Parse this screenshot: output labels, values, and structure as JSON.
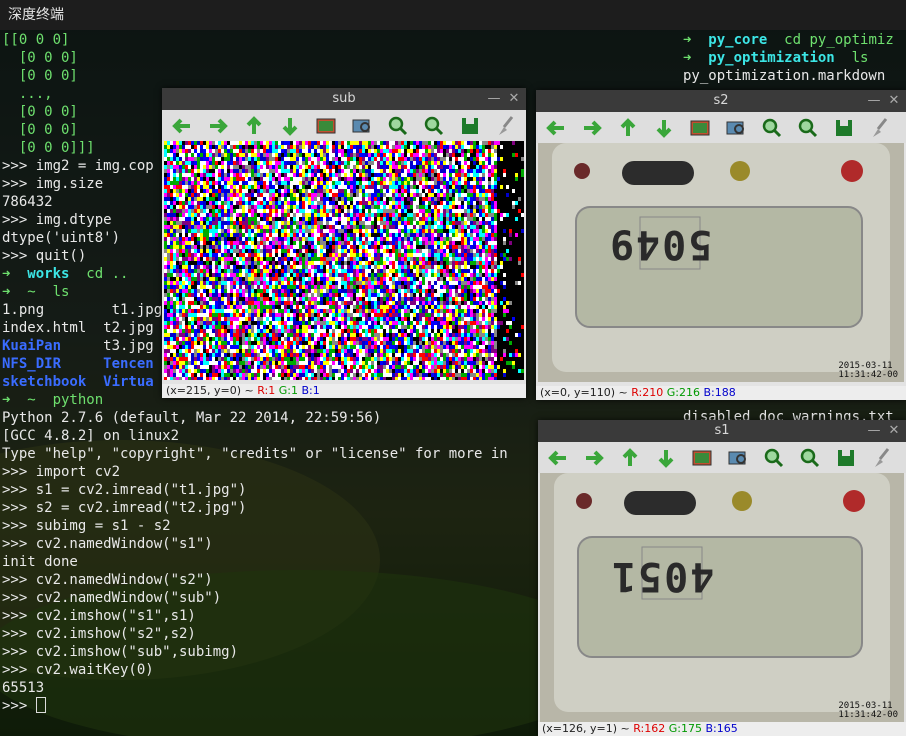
{
  "window_title": "深度终端",
  "terminal_lines": [
    [
      [
        "[[0 0 0]",
        "g"
      ]
    ],
    [
      [
        "  [0 0 0]",
        "g"
      ]
    ],
    [
      [
        "  [0 0 0]",
        "g"
      ]
    ],
    [
      [
        "  ...,",
        "g"
      ]
    ],
    [
      [
        "  [0 0 0]",
        "g"
      ]
    ],
    [
      [
        "  [0 0 0]",
        "g"
      ]
    ],
    [
      [
        "  [0 0 0]]]",
        "g"
      ]
    ],
    [
      [
        ">>> img2 = img.cop",
        "w"
      ]
    ],
    [
      [
        ">>> img.size",
        "w"
      ]
    ],
    [
      [
        "786432",
        "w"
      ]
    ],
    [
      [
        ">>> img.dtype",
        "w"
      ]
    ],
    [
      [
        "dtype('uint8')",
        "w"
      ]
    ],
    [
      [
        ">>> quit()",
        "w"
      ]
    ],
    [
      [
        "➜  ",
        "g"
      ],
      [
        "works",
        "c"
      ],
      [
        "  cd ..",
        "g"
      ]
    ],
    [
      [
        "➜  ~  ls",
        "g"
      ]
    ],
    [
      [
        "1.png        t1.jpg",
        "w"
      ]
    ],
    [
      [
        "index.html  t2.jpg",
        "w"
      ]
    ],
    [
      [
        "KuaiPan     ",
        "b"
      ],
      [
        "t3.jpg",
        "w"
      ]
    ],
    [
      [
        "NFS_DIR     Tencen",
        "b"
      ]
    ],
    [
      [
        "sketchbook  Virtua",
        "b"
      ]
    ],
    [
      [
        "➜  ~  python",
        "g"
      ]
    ],
    [
      [
        "Python 2.7.6 (default, Mar 22 2014, 22:59:56)",
        "w"
      ]
    ],
    [
      [
        "[GCC 4.8.2] on linux2",
        "w"
      ]
    ],
    [
      [
        "Type \"help\", \"copyright\", \"credits\" or \"license\" for more in",
        "w"
      ]
    ],
    [
      [
        ">>> import cv2",
        "w"
      ]
    ],
    [
      [
        ">>> s1 = cv2.imread(\"t1.jpg\")",
        "w"
      ]
    ],
    [
      [
        ">>> s2 = cv2.imread(\"t2.jpg\")",
        "w"
      ]
    ],
    [
      [
        ">>> subimg = s1 - s2",
        "w"
      ]
    ],
    [
      [
        ">>> cv2.namedWindow(\"s1\")",
        "w"
      ]
    ],
    [
      [
        "init done",
        "w"
      ]
    ],
    [
      [
        ">>> cv2.namedWindow(\"s2\")",
        "w"
      ]
    ],
    [
      [
        ">>> cv2.namedWindow(\"sub\")",
        "w"
      ]
    ],
    [
      [
        ">>> cv2.imshow(\"s1\",s1)",
        "w"
      ]
    ],
    [
      [
        ">>> cv2.imshow(\"s2\",s2)",
        "w"
      ]
    ],
    [
      [
        ">>> cv2.imshow(\"sub\",subimg)",
        "w"
      ]
    ],
    [
      [
        ">>> cv2.waitKey(0)",
        "w"
      ]
    ],
    [
      [
        "65513",
        "w"
      ]
    ],
    [
      [
        ">>> ",
        "w"
      ]
    ]
  ],
  "right_lines": [
    [
      [
        "➜  ",
        "g"
      ],
      [
        "py_core",
        "c"
      ],
      [
        "  cd py_optimiz",
        "g"
      ]
    ],
    [
      [
        "➜  ",
        "g"
      ],
      [
        "py_optimization",
        "c"
      ],
      [
        "  ls",
        "g"
      ]
    ],
    [
      [
        "py_optimization.markdown",
        "w"
      ]
    ]
  ],
  "right_extra": "disabled_doc_warnings.txt",
  "windows": {
    "sub": {
      "title": "sub",
      "status": "(x=215, y=0) ~ ",
      "r": "R:1",
      "g": "G:1",
      "b": "B:1"
    },
    "s2": {
      "title": "s2",
      "status": "(x=0, y=110) ~ ",
      "r": "R:210",
      "g": "G:216",
      "b": "B:188",
      "lcd": "5049",
      "timestamp": "2015-03-11\n11:31:42-00"
    },
    "s1": {
      "title": "s1",
      "status": "(x=126, y=1) ~ ",
      "r": "R:162",
      "g": "G:175",
      "b": "B:165",
      "lcd": "4051",
      "timestamp": "2015-03-11\n11:31:42-00"
    }
  },
  "toolbar_icons": [
    "arrow-left-icon",
    "arrow-right-icon",
    "arrow-up-icon",
    "arrow-down-icon",
    "image-icon",
    "zoom-fit-icon",
    "zoom-in-icon",
    "zoom-out-icon",
    "save-icon",
    "brush-icon"
  ],
  "colors": {
    "accent": "#3ce6e6",
    "prompt": "#6ee06e",
    "dir": "#3a6cff",
    "toolbar_green": "#3aa63a"
  }
}
